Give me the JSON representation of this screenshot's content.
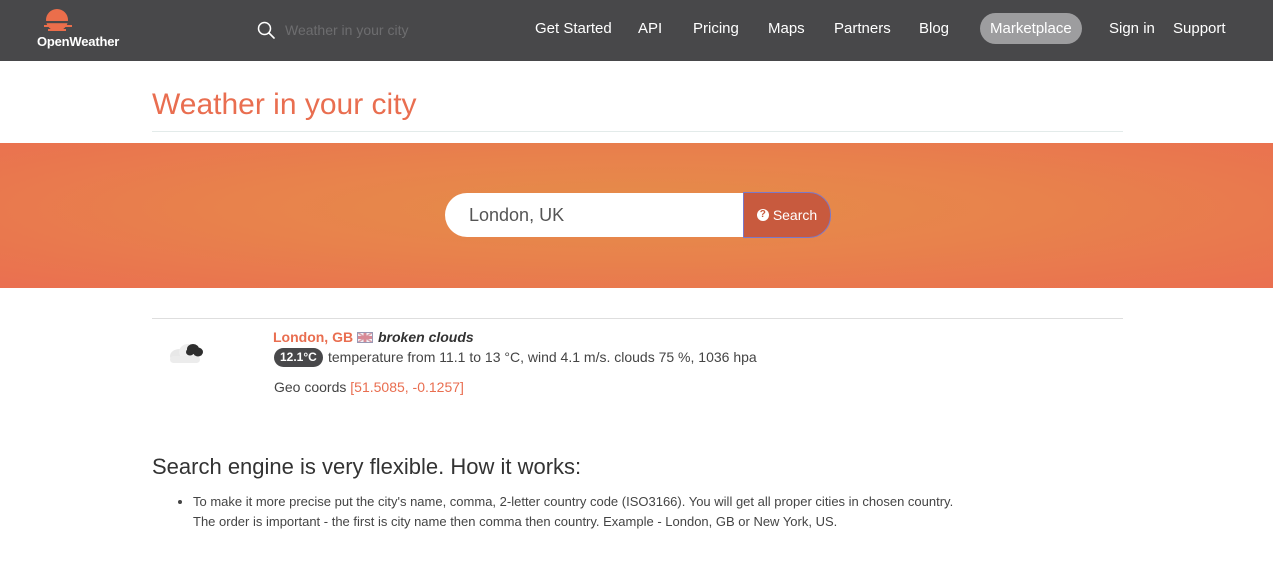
{
  "nav": {
    "logo_text": "OpenWeather",
    "search_placeholder": "Weather in your city",
    "links": {
      "get_started": "Get Started",
      "api": "API",
      "pricing": "Pricing",
      "maps": "Maps",
      "partners": "Partners",
      "blog": "Blog",
      "marketplace": "Marketplace",
      "sign_in": "Sign in",
      "support": "Support"
    }
  },
  "page": {
    "title": "Weather in your city"
  },
  "hero": {
    "search_value": "London, UK",
    "search_button": "Search",
    "search_button_icon": "question-circle-icon"
  },
  "result": {
    "city": "London, GB",
    "description": "broken clouds",
    "temperature": "12.1°C",
    "details": "temperature from 11.1 to 13 °C, wind 4.1 m/s. clouds 75 %, 1036 hpa",
    "geo_label": "Geo coords",
    "geo_coords": "[51.5085, -0.1257]",
    "icon": "broken-clouds-icon"
  },
  "how_it_works": {
    "title": "Search engine is very flexible. How it works:",
    "items": [
      {
        "line1": "To make it more precise put the city's name, comma, 2-letter country code (ISO3166). You will get all proper cities in chosen country.",
        "line2": "The order is important - the first is city name then comma then country. Example - London, GB or New York, US."
      }
    ]
  },
  "colors": {
    "accent": "#e96e50",
    "nav_bg": "#48484a",
    "hero_gradient_center": "#e58d49",
    "hero_gradient_edge": "#ea6f50",
    "search_button_bg": "#c85a3e"
  }
}
